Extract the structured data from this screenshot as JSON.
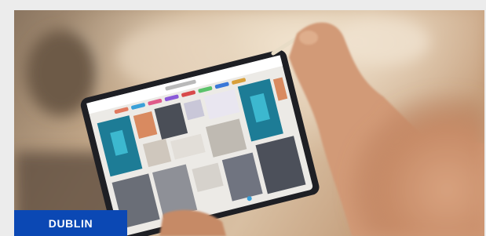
{
  "card": {
    "location_label": "DUBLIN",
    "image_icon": "photo-tablet-moodboard"
  },
  "colors": {
    "page_bg": "#ececec",
    "badge_bg": "#0b48b4",
    "badge_text": "#ffffff"
  }
}
